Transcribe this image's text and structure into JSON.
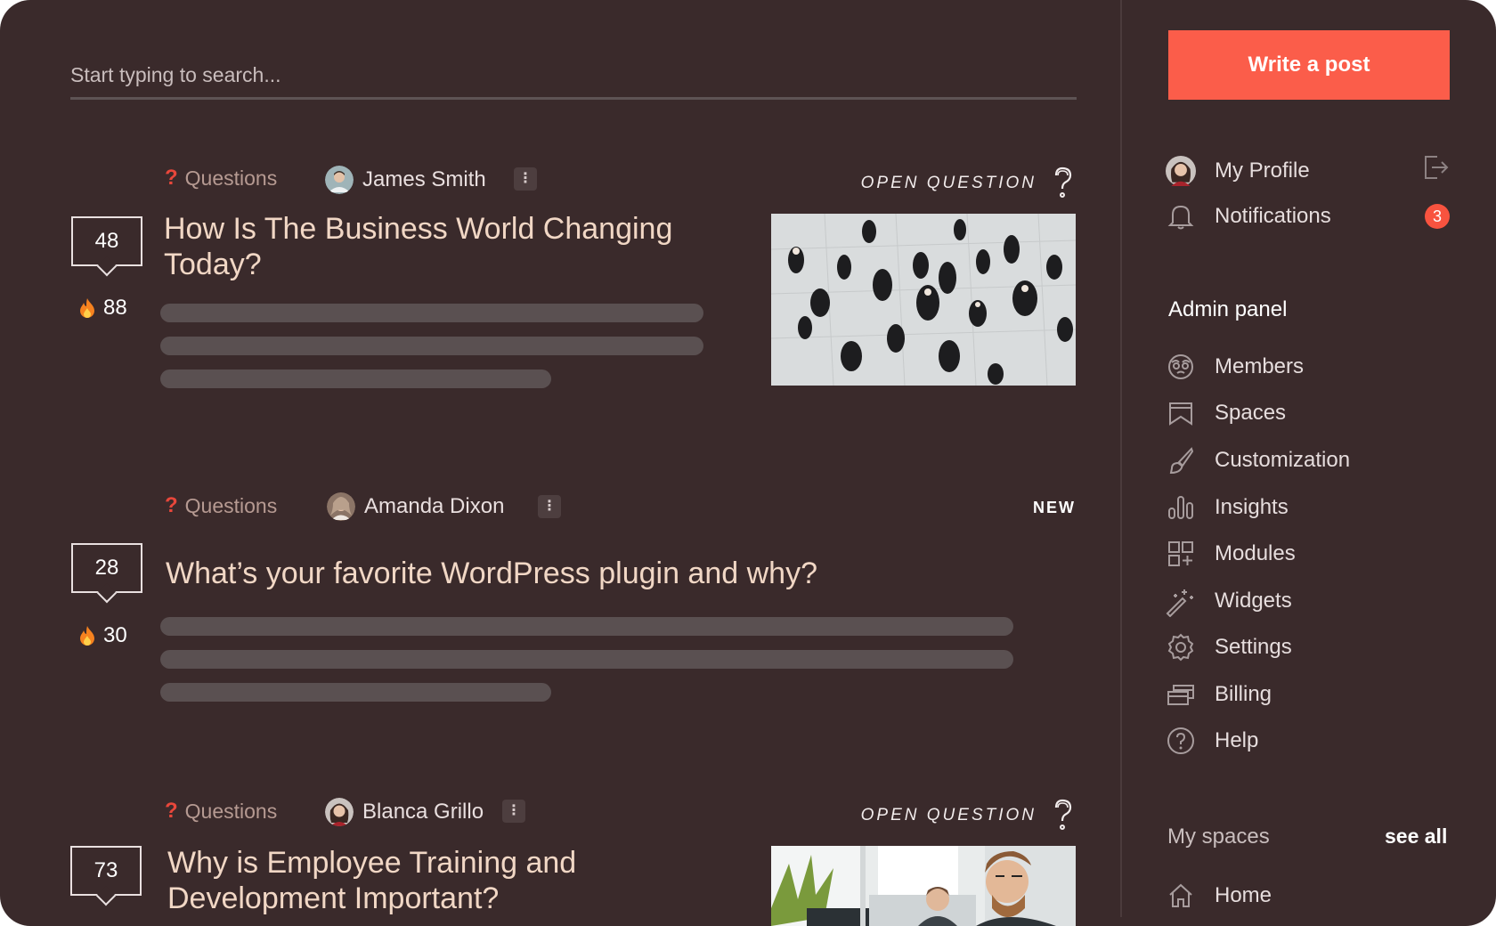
{
  "search": {
    "placeholder": "Start typing to search..."
  },
  "posts": [
    {
      "category": "Questions",
      "author": "James Smith",
      "kebab": "⋮",
      "status": "OPEN QUESTION",
      "comments": "48",
      "hot": "88",
      "title_lines": [
        "How Is The Business World Changing",
        "Today?"
      ]
    },
    {
      "category": "Questions",
      "author": "Amanda Dixon",
      "kebab": "⋮",
      "status": "NEW",
      "comments": "28",
      "hot": "30",
      "title_lines": [
        "What’s your favorite WordPress plugin and why?"
      ]
    },
    {
      "category": "Questions",
      "author": "Blanca Grillo",
      "kebab": "⋮",
      "status": "OPEN QUESTION",
      "comments": "73",
      "title_lines": [
        "Why is Employee Training and",
        "Development Important?"
      ]
    }
  ],
  "sidebar": {
    "write_post": "Write a post",
    "profile": "My Profile",
    "notifications": "Notifications",
    "notifications_count": "3",
    "admin_heading": "Admin panel",
    "admin_items": [
      "Members",
      "Spaces",
      "Customization",
      "Insights",
      "Modules",
      "Widgets",
      "Settings",
      "Billing",
      "Help"
    ],
    "my_spaces": "My spaces",
    "see_all": "see all",
    "home": "Home"
  },
  "colors": {
    "background": "#3a2a2b",
    "accent": "#fb5d4a",
    "title": "#f1d7c5",
    "category": "#b69a92",
    "badge": "#f8533f"
  },
  "icons": [
    "question-mark-icon",
    "kebab-menu-icon",
    "open-question-icon",
    "comment-bubble-icon",
    "fire-icon",
    "logout-icon",
    "bell-icon",
    "members-icon",
    "spaces-icon",
    "customization-icon",
    "insights-icon",
    "modules-icon",
    "widgets-icon",
    "settings-icon",
    "billing-icon",
    "help-icon",
    "home-icon"
  ]
}
